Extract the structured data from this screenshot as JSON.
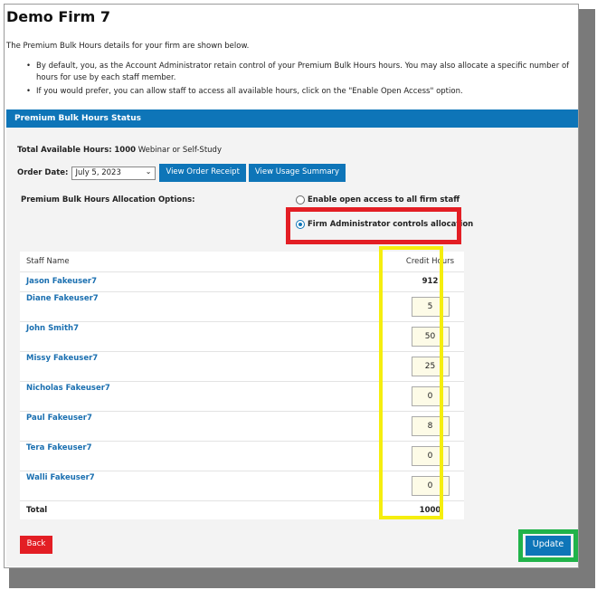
{
  "page": {
    "title": "Demo Firm 7",
    "intro": "The Premium Bulk Hours details for your firm are shown below.",
    "bullets": [
      "By default, you, as the Account Administrator retain control of your Premium Bulk Hours hours. You may also allocate a specific number of hours for use by each staff member.",
      "If you would prefer, you can allow staff to access all available hours, click on the \"Enable Open Access\" option."
    ]
  },
  "panel": {
    "header": "Premium Bulk Hours Status",
    "available_label": "Total Available Hours:",
    "available_value": "1000",
    "available_suffix": "Webinar or Self-Study",
    "order_date_label": "Order Date:",
    "order_date_value": "July 5, 2023",
    "view_order_receipt": "View Order Receipt",
    "view_usage_summary": "View Usage Summary",
    "allocation_label": "Premium Bulk Hours Allocation Options:",
    "option_open": "Enable open access to all firm staff",
    "option_admin": "Firm Administrator controls allocation",
    "selected_option": "admin"
  },
  "table": {
    "col_staff": "Staff Name",
    "col_hours": "Credit Hours",
    "rows": [
      {
        "name": "Jason Fakeuser7",
        "hours": "912"
      },
      {
        "name": "Diane Fakeuser7",
        "hours": "5"
      },
      {
        "name": "John Smith7",
        "hours": "50"
      },
      {
        "name": "Missy Fakeuser7",
        "hours": "25"
      },
      {
        "name": "Nicholas Fakeuser7",
        "hours": "0"
      },
      {
        "name": "Paul Fakeuser7",
        "hours": "8"
      },
      {
        "name": "Tera Fakeuser7",
        "hours": "0"
      },
      {
        "name": "Walli Fakeuser7",
        "hours": "0"
      }
    ],
    "total_label": "Total",
    "total_value": "1000"
  },
  "actions": {
    "back": "Back",
    "update": "Update"
  },
  "colors": {
    "brand_blue": "#0e75b8",
    "highlight_red": "#e31e24",
    "highlight_yellow": "#f5ee0e",
    "highlight_green": "#21b34a",
    "link_blue": "#1a6fb0"
  }
}
